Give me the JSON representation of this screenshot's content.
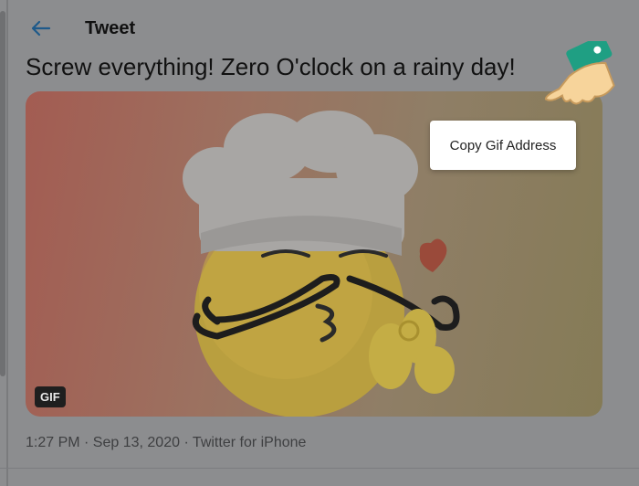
{
  "header": {
    "back_icon": "arrow-left-icon",
    "title": "Tweet"
  },
  "tweet": {
    "text": "Screw everything! Zero O'clock on a rainy day!",
    "media": {
      "badge": "GIF",
      "subject_icon": "chef-emoji-icon"
    },
    "timestamp": "1:27 PM · Sep 13, 2020 · Twitter for iPhone"
  },
  "context_menu": {
    "items": [
      {
        "label": "Copy Gif Address"
      }
    ]
  },
  "pointer": {
    "icon": "pointing-hand-icon"
  },
  "colors": {
    "accent": "#1f5a8a",
    "overlay_bg": "#8c8d8f",
    "menu_bg": "#ffffff"
  }
}
